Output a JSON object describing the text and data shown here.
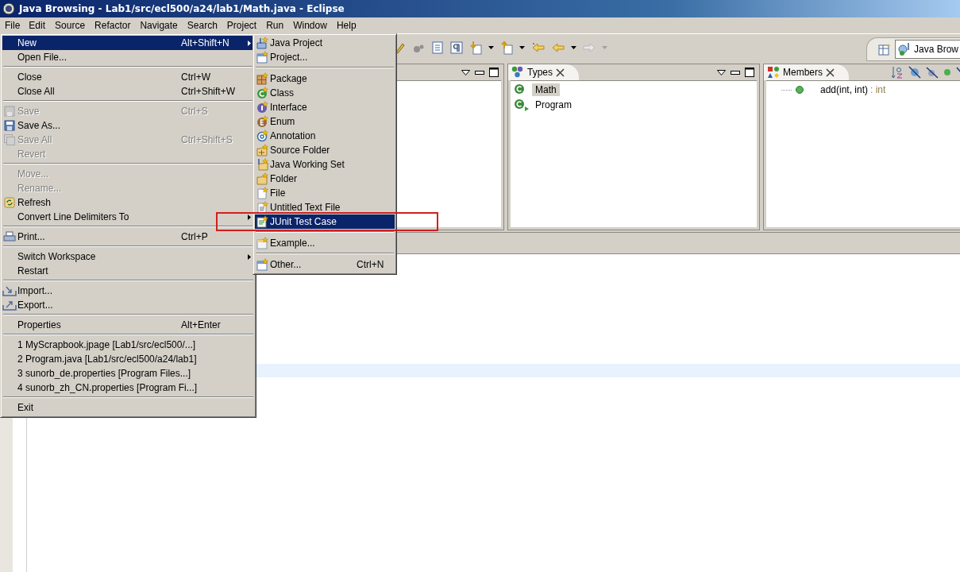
{
  "window": {
    "title": "Java Browsing - Lab1/src/ecl500/a24/lab1/Math.java - Eclipse"
  },
  "menu_bar": [
    {
      "label": "File",
      "selected": true
    },
    {
      "label": "Edit",
      "selected": false
    },
    {
      "label": "Source",
      "selected": false
    },
    {
      "label": "Refactor",
      "selected": false
    },
    {
      "label": "Navigate",
      "selected": false
    },
    {
      "label": "Search",
      "selected": false
    },
    {
      "label": "Project",
      "selected": false
    },
    {
      "label": "Run",
      "selected": false
    },
    {
      "label": "Window",
      "selected": false
    },
    {
      "label": "Help",
      "selected": false
    }
  ],
  "perspective": {
    "label": "Java Brow"
  },
  "types_view": {
    "title": "Types",
    "items": [
      {
        "label": "Math",
        "selected": true,
        "runnable": false
      },
      {
        "label": "Program",
        "selected": false,
        "runnable": true
      }
    ]
  },
  "members_view": {
    "title": "Members",
    "items": [
      {
        "label": "add(int, int)",
        "type": " : int"
      }
    ]
  },
  "file_menu": {
    "items": [
      {
        "kind": "item",
        "label": "New",
        "shortcut": "Alt+Shift+N",
        "submenu": true,
        "selected": true,
        "disabled": false
      },
      {
        "kind": "item",
        "label": "Open File...",
        "submenu": false,
        "selected": false,
        "disabled": false
      },
      {
        "kind": "separator"
      },
      {
        "kind": "item",
        "label": "Close",
        "shortcut": "Ctrl+W",
        "submenu": false,
        "selected": false,
        "disabled": false
      },
      {
        "kind": "item",
        "label": "Close All",
        "shortcut": "Ctrl+Shift+W",
        "submenu": false,
        "selected": false,
        "disabled": false
      },
      {
        "kind": "separator"
      },
      {
        "kind": "item",
        "label": "Save",
        "shortcut": "Ctrl+S",
        "submenu": false,
        "selected": false,
        "disabled": true
      },
      {
        "kind": "item",
        "label": "Save As...",
        "submenu": false,
        "selected": false,
        "disabled": false
      },
      {
        "kind": "item",
        "label": "Save All",
        "shortcut": "Ctrl+Shift+S",
        "submenu": false,
        "selected": false,
        "disabled": true
      },
      {
        "kind": "item",
        "label": "Revert",
        "submenu": false,
        "selected": false,
        "disabled": true
      },
      {
        "kind": "separator"
      },
      {
        "kind": "item",
        "label": "Move...",
        "submenu": false,
        "selected": false,
        "disabled": true
      },
      {
        "kind": "item",
        "label": "Rename...",
        "submenu": false,
        "selected": false,
        "disabled": true
      },
      {
        "kind": "item",
        "label": "Refresh",
        "submenu": false,
        "selected": false,
        "disabled": false
      },
      {
        "kind": "item",
        "label": "Convert Line Delimiters To",
        "submenu": true,
        "selected": false,
        "disabled": false
      },
      {
        "kind": "separator"
      },
      {
        "kind": "item",
        "label": "Print...",
        "shortcut": "Ctrl+P",
        "submenu": false,
        "selected": false,
        "disabled": false
      },
      {
        "kind": "separator"
      },
      {
        "kind": "item",
        "label": "Switch Workspace",
        "submenu": true,
        "selected": false,
        "disabled": false
      },
      {
        "kind": "item",
        "label": "Restart",
        "submenu": false,
        "selected": false,
        "disabled": false
      },
      {
        "kind": "separator"
      },
      {
        "kind": "item",
        "label": "Import...",
        "submenu": false,
        "selected": false,
        "disabled": false
      },
      {
        "kind": "item",
        "label": "Export...",
        "submenu": false,
        "selected": false,
        "disabled": false
      },
      {
        "kind": "separator"
      },
      {
        "kind": "item",
        "label": "Properties",
        "shortcut": "Alt+Enter",
        "submenu": false,
        "selected": false,
        "disabled": false
      },
      {
        "kind": "separator"
      },
      {
        "kind": "item",
        "label": "1 MyScrapbook.jpage  [Lab1/src/ecl500/...]",
        "submenu": false,
        "selected": false,
        "disabled": false
      },
      {
        "kind": "item",
        "label": "2 Program.java  [Lab1/src/ecl500/a24/lab1]",
        "submenu": false,
        "selected": false,
        "disabled": false
      },
      {
        "kind": "item",
        "label": "3 sunorb_de.properties  [Program Files...]",
        "submenu": false,
        "selected": false,
        "disabled": false
      },
      {
        "kind": "item",
        "label": "4 sunorb_zh_CN.properties  [Program Fi...]",
        "submenu": false,
        "selected": false,
        "disabled": false
      },
      {
        "kind": "separator"
      },
      {
        "kind": "item",
        "label": "Exit",
        "submenu": false,
        "selected": false,
        "disabled": false
      }
    ]
  },
  "new_submenu": {
    "items": [
      {
        "kind": "item",
        "label": "Java Project",
        "selected": false
      },
      {
        "kind": "item",
        "label": "Project...",
        "selected": false
      },
      {
        "kind": "separator"
      },
      {
        "kind": "item",
        "label": "Package",
        "selected": false
      },
      {
        "kind": "item",
        "label": "Class",
        "selected": false
      },
      {
        "kind": "item",
        "label": "Interface",
        "selected": false
      },
      {
        "kind": "item",
        "label": "Enum",
        "selected": false
      },
      {
        "kind": "item",
        "label": "Annotation",
        "selected": false
      },
      {
        "kind": "item",
        "label": "Source Folder",
        "selected": false
      },
      {
        "kind": "item",
        "label": "Java Working Set",
        "selected": false
      },
      {
        "kind": "item",
        "label": "Folder",
        "selected": false
      },
      {
        "kind": "item",
        "label": "File",
        "selected": false
      },
      {
        "kind": "item",
        "label": "Untitled Text File",
        "selected": false
      },
      {
        "kind": "item",
        "label": "JUnit Test Case",
        "selected": true
      },
      {
        "kind": "separator"
      },
      {
        "kind": "item",
        "label": "Example...",
        "selected": false
      },
      {
        "kind": "separator"
      },
      {
        "kind": "item",
        "label": "Other...",
        "shortcut": "Ctrl+N",
        "selected": false
      }
    ]
  }
}
